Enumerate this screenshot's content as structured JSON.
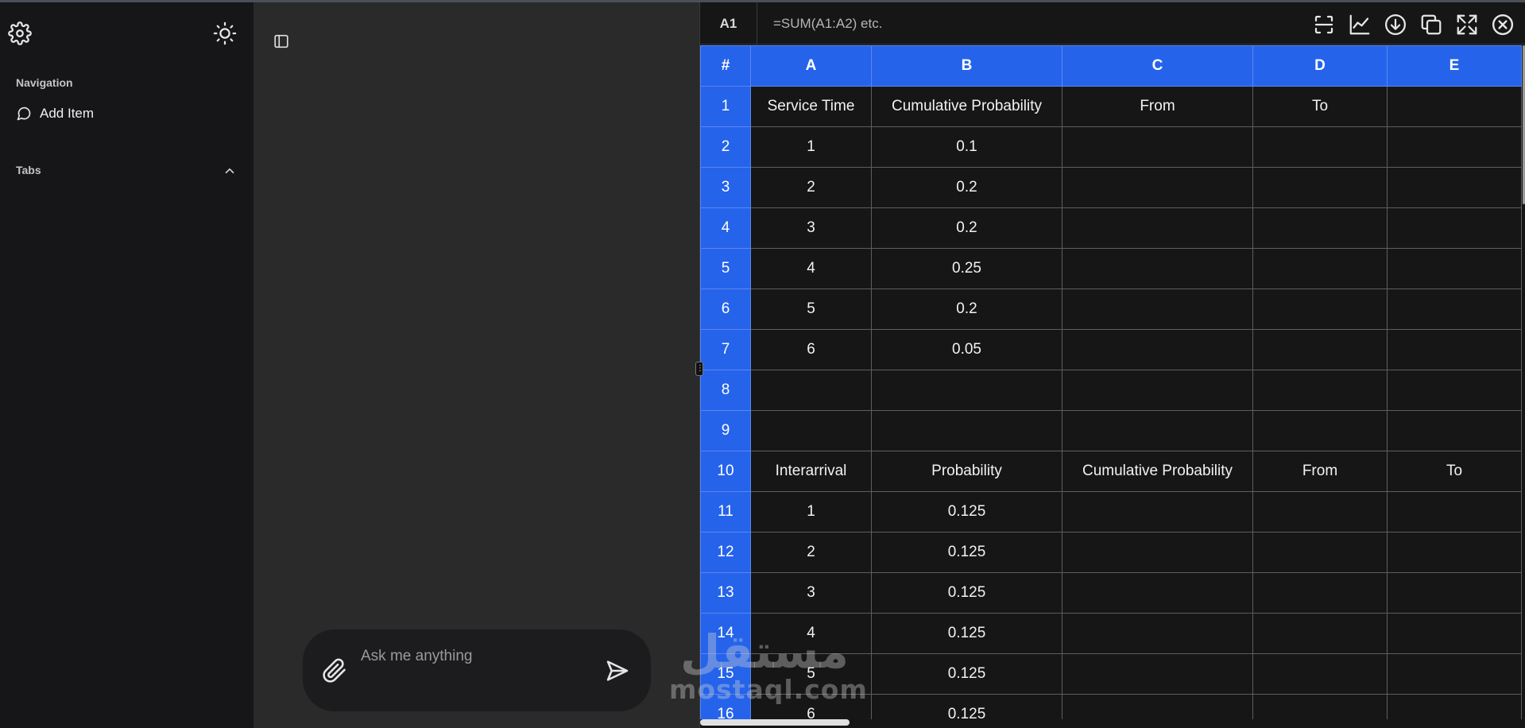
{
  "sidebar": {
    "navigation_label": "Navigation",
    "add_item_label": "Add Item",
    "tabs_label": "Tabs"
  },
  "chat": {
    "placeholder": "Ask me anything"
  },
  "sheet": {
    "cell_ref": "A1",
    "formula_placeholder": "=SUM(A1:A2) etc.",
    "corner": "#",
    "columns": [
      "A",
      "B",
      "C",
      "D",
      "E"
    ],
    "rows": [
      {
        "n": "1",
        "cells": [
          "Service Time",
          "Cumulative Probability",
          "From",
          "To",
          ""
        ]
      },
      {
        "n": "2",
        "cells": [
          "1",
          "0.1",
          "",
          "",
          ""
        ]
      },
      {
        "n": "3",
        "cells": [
          "2",
          "0.2",
          "",
          "",
          ""
        ]
      },
      {
        "n": "4",
        "cells": [
          "3",
          "0.2",
          "",
          "",
          ""
        ]
      },
      {
        "n": "5",
        "cells": [
          "4",
          "0.25",
          "",
          "",
          ""
        ]
      },
      {
        "n": "6",
        "cells": [
          "5",
          "0.2",
          "",
          "",
          ""
        ]
      },
      {
        "n": "7",
        "cells": [
          "6",
          "0.05",
          "",
          "",
          ""
        ]
      },
      {
        "n": "8",
        "cells": [
          "",
          "",
          "",
          "",
          ""
        ]
      },
      {
        "n": "9",
        "cells": [
          "",
          "",
          "",
          "",
          ""
        ]
      },
      {
        "n": "10",
        "cells": [
          "Interarrival",
          "Probability",
          "Cumulative Probability",
          "From",
          "To"
        ]
      },
      {
        "n": "11",
        "cells": [
          "1",
          "0.125",
          "",
          "",
          ""
        ]
      },
      {
        "n": "12",
        "cells": [
          "2",
          "0.125",
          "",
          "",
          ""
        ]
      },
      {
        "n": "13",
        "cells": [
          "3",
          "0.125",
          "",
          "",
          ""
        ]
      },
      {
        "n": "14",
        "cells": [
          "4",
          "0.125",
          "",
          "",
          ""
        ]
      },
      {
        "n": "15",
        "cells": [
          "5",
          "0.125",
          "",
          "",
          ""
        ]
      },
      {
        "n": "16",
        "cells": [
          "6",
          "0.125",
          "",
          "",
          ""
        ]
      }
    ],
    "header_color": "#2563eb"
  },
  "watermark": {
    "arabic": "مستقل",
    "latin": "mostaql.com"
  }
}
